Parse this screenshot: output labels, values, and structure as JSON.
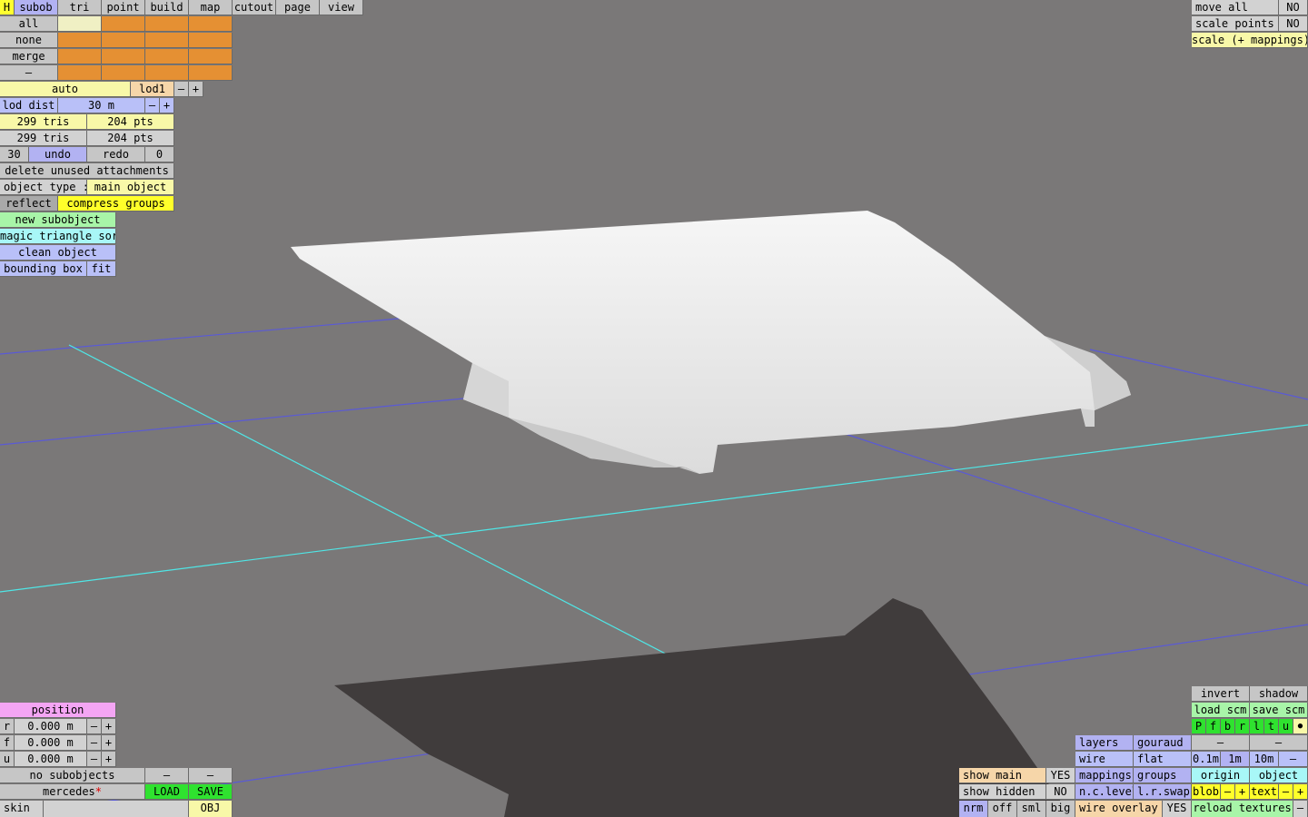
{
  "menu": {
    "home": "H",
    "tabs": [
      "subob",
      "tri",
      "point",
      "build",
      "map",
      "cutout",
      "page",
      "view"
    ]
  },
  "select": {
    "all": "all",
    "none": "none",
    "merge": "merge",
    "minus": "–"
  },
  "lod": {
    "mode": "auto",
    "name": "lod1",
    "minus": "–",
    "plus": "+",
    "dist_label": "lod dist",
    "dist_value": "30 m"
  },
  "stats": {
    "tris1": "299 tris",
    "pts1": "204 pts",
    "tris2": "299 tris",
    "pts2": "204 pts"
  },
  "history": {
    "count": "30",
    "undo": "undo",
    "redo": "redo",
    "redo_count": "0"
  },
  "actions": {
    "delete_unused": "delete unused attachments",
    "object_type_label": "object type :",
    "object_type_value": "main object",
    "reflect": "reflect",
    "compress_groups": "compress groups",
    "new_subobject": "new subobject",
    "magic_sort": "magic triangle sort",
    "clean_object": "clean object",
    "bounding_box": "bounding box",
    "fit": "fit"
  },
  "transform": {
    "move_all": "move all",
    "move_all_val": "NO",
    "scale_points": "scale points",
    "scale_points_val": "NO",
    "scale_mappings": "scale (+ mappings)"
  },
  "position": {
    "title": "position",
    "rows": [
      {
        "axis": "r",
        "value": "0.000 m"
      },
      {
        "axis": "f",
        "value": "0.000 m"
      },
      {
        "axis": "u",
        "value": "0.000 m"
      }
    ],
    "minus": "–",
    "plus": "+"
  },
  "file": {
    "no_subobjects": "no subobjects",
    "dash": "–",
    "name": "mercedes",
    "modified": "*",
    "load": "LOAD",
    "save": "SAVE",
    "skin": "skin",
    "obj": "OBJ"
  },
  "display": {
    "show_main": "show main",
    "show_main_val": "YES",
    "show_hidden": "show hidden",
    "show_hidden_val": "NO",
    "nrm": "nrm",
    "off": "off",
    "sml": "sml",
    "big": "big",
    "layers": "layers",
    "gouraud": "gouraud",
    "wire": "wire",
    "flat": "flat",
    "mappings": "mappings",
    "groups": "groups",
    "nc_level": "n.c.level",
    "lr_swap": "l.r.swap",
    "wire_overlay": "wire overlay",
    "wire_overlay_val": "YES"
  },
  "view_panel": {
    "invert": "invert",
    "shadow": "shadow",
    "load_scm": "load scm",
    "save_scm": "save scm",
    "flags": [
      "P",
      "f",
      "b",
      "r",
      "l",
      "t",
      "u"
    ],
    "dot": "●",
    "dash": "–",
    "steps": [
      "0.1m",
      "1m",
      "10m"
    ],
    "origin": "origin",
    "object": "object",
    "blob": "blob",
    "text": "text",
    "minus": "–",
    "plus": "+",
    "reload_textures": "reload textures"
  },
  "colors": {
    "viewport_bg": "#7a7878",
    "grid_blue": "#5a5ad6",
    "grid_cyan": "#4fe6e6",
    "mesh": "#ececec",
    "shadow": "#403c3c"
  }
}
